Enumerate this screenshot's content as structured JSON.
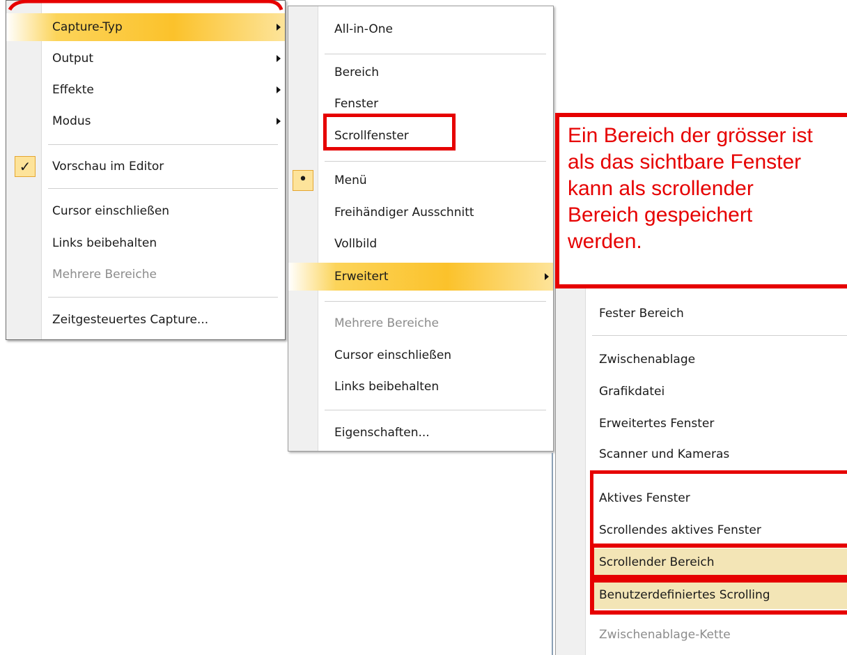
{
  "main_menu": {
    "items": [
      {
        "label": "Capture-Typ"
      },
      {
        "label": "Output"
      },
      {
        "label": "Effekte"
      },
      {
        "label": "Modus"
      },
      {
        "label": "Vorschau im Editor",
        "check": "✓"
      },
      {
        "label": "Cursor einschließen"
      },
      {
        "label": "Links beibehalten"
      },
      {
        "label": "Mehrere Bereiche"
      },
      {
        "label": "Zeitgesteuertes Capture..."
      }
    ]
  },
  "capture_type_menu": {
    "items": [
      {
        "label": "All-in-One"
      },
      {
        "label": "Bereich"
      },
      {
        "label": "Fenster"
      },
      {
        "label": "Scrollfenster"
      },
      {
        "label": "Menü",
        "bullet": "•"
      },
      {
        "label": "Freihändiger Ausschnitt"
      },
      {
        "label": "Vollbild"
      },
      {
        "label": "Erweitert"
      },
      {
        "label": "Mehrere Bereiche"
      },
      {
        "label": "Cursor einschließen"
      },
      {
        "label": "Links beibehalten"
      },
      {
        "label": "Eigenschaften..."
      }
    ]
  },
  "advanced_menu": {
    "items": [
      {
        "label": "Fester Bereich"
      },
      {
        "label": "Zwischenablage"
      },
      {
        "label": "Grafikdatei"
      },
      {
        "label": "Erweitertes Fenster"
      },
      {
        "label": "Scanner und Kameras"
      },
      {
        "label": "Aktives Fenster"
      },
      {
        "label": "Scrollendes aktives Fenster"
      },
      {
        "label": "Scrollender Bereich"
      },
      {
        "label": "Benutzerdefiniertes Scrolling"
      },
      {
        "label": "Zwischenablage-Kette"
      }
    ]
  },
  "callout": {
    "lines": [
      "Ein Bereich der grösser ist",
      "als das sichtbare Fenster",
      "kann als scrollender",
      "Bereich gespeichert",
      "werden."
    ]
  },
  "colors": {
    "annotation_red": "#e60000",
    "highlight_orange": "#fbc22b",
    "highlight_tan": "#f3e5b6"
  }
}
